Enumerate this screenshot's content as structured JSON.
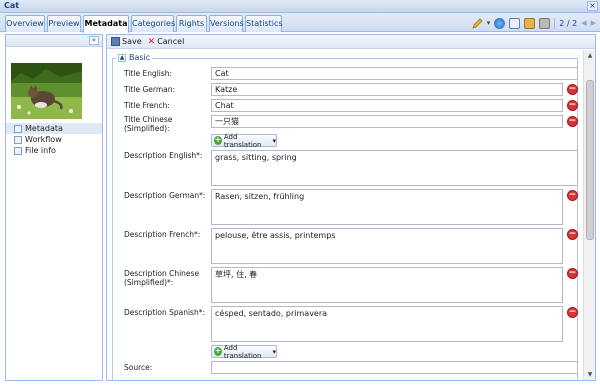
{
  "window": {
    "title": "Cat",
    "close_glyph": "×"
  },
  "tabs": [
    {
      "label": "Overview"
    },
    {
      "label": "Preview"
    },
    {
      "label": "Metadata"
    },
    {
      "label": "Categories"
    },
    {
      "label": "Rights"
    },
    {
      "label": "Versions"
    },
    {
      "label": "Statistics"
    }
  ],
  "active_tab": "Metadata",
  "toolbar": {
    "pager": "2 / 2",
    "prev_glyph": "◀",
    "next_glyph": "▶",
    "dropdown_glyph": "▾"
  },
  "sidebar": {
    "collapse_glyph": "«",
    "items": [
      {
        "label": "Metadata"
      },
      {
        "label": "Workflow"
      },
      {
        "label": "File info"
      }
    ]
  },
  "actions": {
    "save": "Save",
    "cancel": "Cancel"
  },
  "section": {
    "label": "Basic",
    "toggle_glyph": "▲"
  },
  "fields": {
    "title_english": {
      "label": "Title English:",
      "value": "Cat"
    },
    "title_german": {
      "label": "Title German:",
      "value": "Katze"
    },
    "title_french": {
      "label": "Title French:",
      "value": "Chat"
    },
    "title_chinese": {
      "label": "Title Chinese (Simplified):",
      "value": "一只猫"
    },
    "desc_english": {
      "label": "Description English*:",
      "value": "grass, sitting, spring"
    },
    "desc_german": {
      "label": "Description German*:",
      "value": "Rasen, sitzen, frühling"
    },
    "desc_french": {
      "label": "Description French*:",
      "value": "pelouse, être assis, printemps"
    },
    "desc_chinese": {
      "label": "Description Chinese (Simplified)*:",
      "value": "草坪, 住, 春"
    },
    "desc_spanish": {
      "label": "Description Spanish*:",
      "value": "césped, sentado, primavera"
    },
    "source": {
      "label": "Source:",
      "value": ""
    }
  },
  "add_translation": {
    "label": "Add translation",
    "arrow": "▾"
  },
  "buttons": {
    "delete_glyph": "−",
    "add_glyph": "+"
  }
}
